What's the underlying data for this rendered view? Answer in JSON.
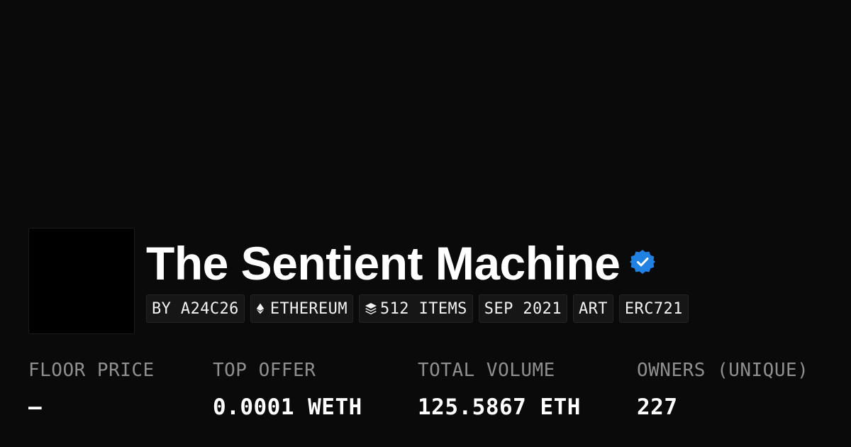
{
  "collection": {
    "title": "The Sentient Machine",
    "verified": true,
    "verified_badge_color": "#2081e2"
  },
  "tags": [
    {
      "label": "BY A24C26",
      "icon": null
    },
    {
      "label": "ETHEREUM",
      "icon": "ethereum-icon"
    },
    {
      "label": "512 ITEMS",
      "icon": "layers-icon"
    },
    {
      "label": "SEP 2021",
      "icon": null
    },
    {
      "label": "ART",
      "icon": null
    },
    {
      "label": "ERC721",
      "icon": null
    }
  ],
  "stats": [
    {
      "label": "FLOOR PRICE",
      "value": "–"
    },
    {
      "label": "TOP OFFER",
      "value": "0.0001 WETH"
    },
    {
      "label": "TOTAL VOLUME",
      "value": "125.5867 ETH"
    },
    {
      "label": "OWNERS (UNIQUE)",
      "value": "227"
    }
  ],
  "colors": {
    "background": "#0a0a0a",
    "label": "#8f8f8f",
    "text": "#ffffff",
    "tag_background": "#161616"
  }
}
